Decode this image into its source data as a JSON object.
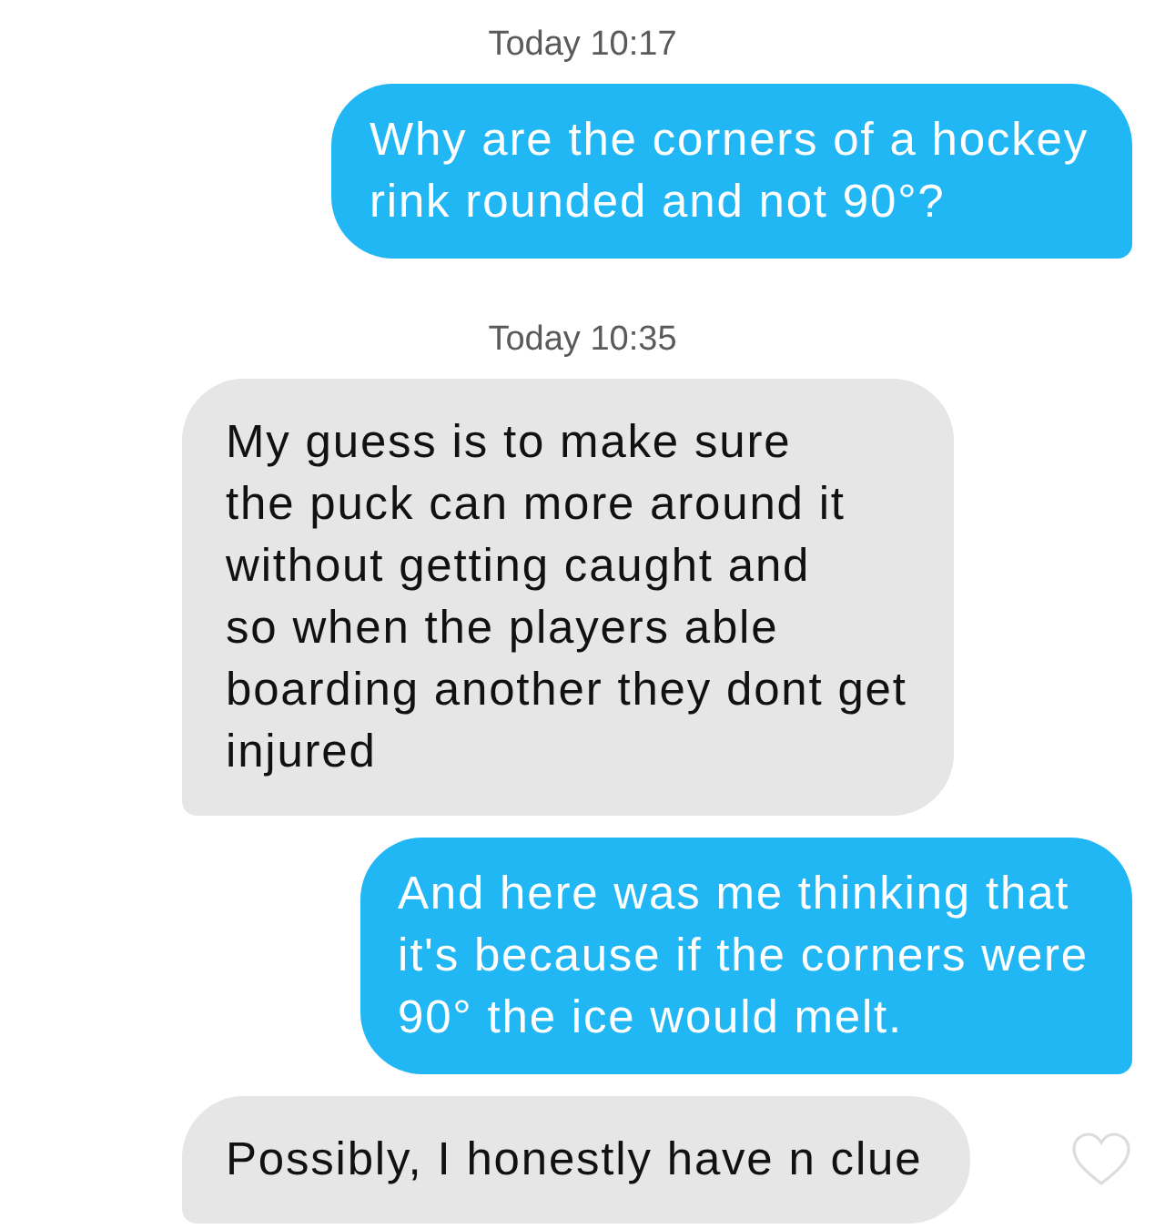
{
  "messages": [
    {
      "kind": "timestamp",
      "text": "Today 10:17"
    },
    {
      "kind": "sent",
      "lines": [
        "Why are the corners of a hockey",
        "rink rounded and not 90°?"
      ]
    },
    {
      "kind": "timestamp",
      "text": "Today 10:35"
    },
    {
      "kind": "received",
      "lines": [
        "My guess is to make sure",
        "the puck can more around it",
        "without getting caught and",
        "so when the players able",
        "boarding another they dont get",
        "injured"
      ]
    },
    {
      "kind": "sent",
      "lines": [
        "And here was me thinking that",
        "it's because if the corners were",
        "90° the ice would melt."
      ]
    },
    {
      "kind": "received",
      "lines": [
        "Possibly, I honestly have n clue"
      ],
      "like_button": {
        "liked": false
      }
    }
  ]
}
